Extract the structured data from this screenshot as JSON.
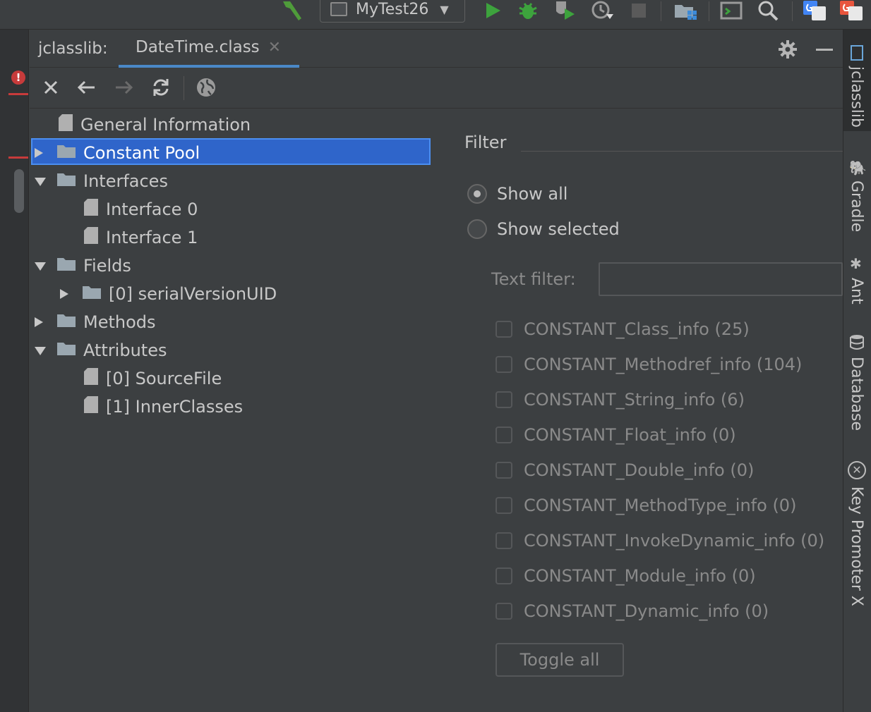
{
  "toolbar": {
    "run_config": "MyTest26",
    "colors": {
      "run": "#3da33d",
      "debug": "#3da33d",
      "build": "#4f9c3a"
    }
  },
  "tool_window": {
    "title": "jclasslib:",
    "tab_label": "DateTime.class",
    "tab_close_icon": "close-icon"
  },
  "tree": {
    "nodes": [
      {
        "label": "General Information",
        "type": "file",
        "expand": "none",
        "indent": 0
      },
      {
        "label": "Constant Pool",
        "type": "folder",
        "expand": "collapsed",
        "indent": 0,
        "selected": true
      },
      {
        "label": "Interfaces",
        "type": "folder",
        "expand": "expanded",
        "indent": 0
      },
      {
        "label": "Interface 0",
        "type": "file",
        "expand": "none",
        "indent": 1
      },
      {
        "label": "Interface 1",
        "type": "file",
        "expand": "none",
        "indent": 1
      },
      {
        "label": "Fields",
        "type": "folder",
        "expand": "expanded",
        "indent": 0
      },
      {
        "label": "[0] serialVersionUID",
        "type": "folder",
        "expand": "collapsed",
        "indent": 1
      },
      {
        "label": "Methods",
        "type": "folder",
        "expand": "collapsed",
        "indent": 0
      },
      {
        "label": "Attributes",
        "type": "folder",
        "expand": "expanded",
        "indent": 0
      },
      {
        "label": "[0] SourceFile",
        "type": "file",
        "expand": "none",
        "indent": 1
      },
      {
        "label": "[1] InnerClasses",
        "type": "file",
        "expand": "none",
        "indent": 1
      }
    ]
  },
  "filter": {
    "title": "Filter",
    "show_all": "Show all",
    "show_selected": "Show selected",
    "selected_mode": "show_all",
    "text_filter_label": "Text filter:",
    "text_filter_value": "",
    "checkboxes": [
      "CONSTANT_Class_info (25)",
      "CONSTANT_Methodref_info (104)",
      "CONSTANT_String_info (6)",
      "CONSTANT_Float_info (0)",
      "CONSTANT_Double_info (0)",
      "CONSTANT_MethodType_info (0)",
      "CONSTANT_InvokeDynamic_info (0)",
      "CONSTANT_Module_info (0)",
      "CONSTANT_Dynamic_info (0)"
    ],
    "toggle_all": "Toggle all"
  },
  "right_strip": {
    "items": [
      "jclasslib",
      "Gradle",
      "Ant",
      "Database",
      "Key Promoter X"
    ]
  }
}
